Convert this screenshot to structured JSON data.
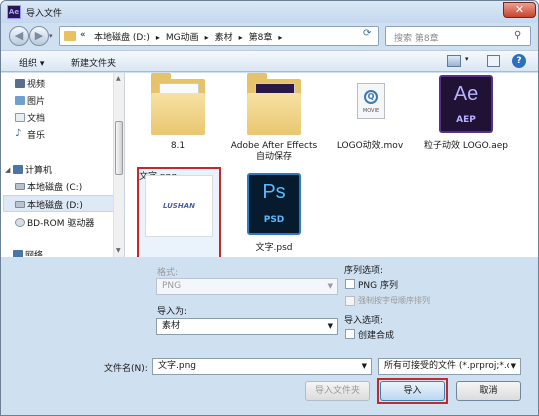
{
  "window": {
    "title": "导入文件",
    "app_icon": "Ae",
    "close_glyph": "✕"
  },
  "nav": {
    "crumbs": [
      "本地磁盘 (D:)",
      "MG动画",
      "素材",
      "第8章"
    ],
    "search_placeholder": "搜索 第8章",
    "lead": "«"
  },
  "toolbar": {
    "organize": "组织 ▾",
    "new_folder": "新建文件夹"
  },
  "sidebar": {
    "items": [
      "视频",
      "图片",
      "文档",
      "音乐",
      "计算机",
      "本地磁盘 (C:)",
      "本地磁盘 (D:)",
      "BD-ROM 驱动器",
      "网络"
    ]
  },
  "files": [
    {
      "name": "8.1",
      "type": "folder",
      "thumb": "ABG"
    },
    {
      "name": "Adobe After Effects 自动保存",
      "type": "folder",
      "thumb": "Ae"
    },
    {
      "name": "LOGO动效.mov",
      "type": "mov",
      "thumb": "MOVIE"
    },
    {
      "name": "粒子动效 LOGO.aep",
      "type": "aep",
      "thumb": "Ae",
      "sub": "AEP"
    },
    {
      "name": "文字.png",
      "type": "png",
      "thumb": "LUSHAN"
    },
    {
      "name": "文字.psd",
      "type": "psd",
      "thumb": "Ps",
      "sub": "PSD"
    }
  ],
  "options": {
    "format_label": "格式:",
    "format_value": "PNG",
    "import_as_label": "导入为:",
    "import_as_value": "素材",
    "sequence_label": "序列选项:",
    "png_sequence": "PNG 序列",
    "force_alpha": "强制按字母顺序排列",
    "import_options_label": "导入选项:",
    "create_comp": "创建合成"
  },
  "footer": {
    "filename_label": "文件名(N):",
    "filename_value": "文字.png",
    "filetype_value": "所有可接受的文件 (*.prproj;*.c",
    "import_folder": "导入文件夹",
    "import": "导入",
    "cancel": "取消"
  },
  "colors": {
    "highlight": "#c02a2a",
    "window_bg": "#cfe0f1"
  }
}
